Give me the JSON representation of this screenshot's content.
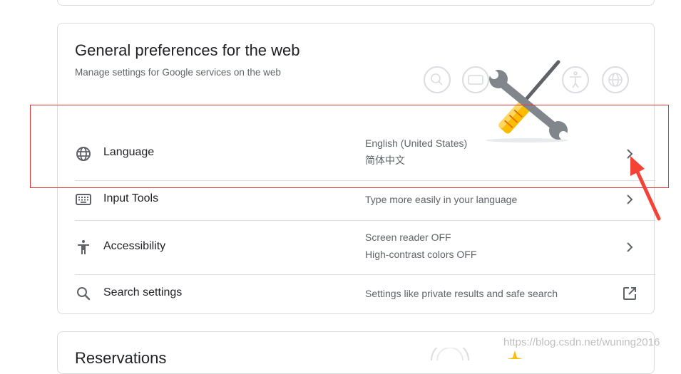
{
  "section": {
    "title": "General preferences for the web",
    "subtitle": "Manage settings for Google services on the web",
    "illustration_icons": [
      "search-icon",
      "keyboard-icon",
      "accessibility-icon",
      "globe-icon",
      "wrench-icon",
      "screwdriver-icon"
    ]
  },
  "rows": [
    {
      "label": "Language",
      "icon": "globe-icon",
      "value_line1": "English (United States)",
      "value_line2": "简体中文",
      "action_icon": "chevron-right-icon"
    },
    {
      "label": "Input Tools",
      "icon": "keyboard-icon",
      "value_line1": "Type more easily in your language",
      "action_icon": "chevron-right-icon"
    },
    {
      "label": "Accessibility",
      "icon": "accessibility-icon",
      "value_line1": "Screen reader OFF",
      "value_line2": "High-contrast colors OFF",
      "action_icon": "chevron-right-icon"
    },
    {
      "label": "Search settings",
      "icon": "search-icon",
      "value_line1": "Settings like private results and safe search",
      "action_icon": "open-in-new-icon"
    }
  ],
  "next_section": {
    "title": "Reservations"
  },
  "annotation": {
    "box_color": "#e53935",
    "arrow_color": "#f44336"
  },
  "watermark": "https://blog.csdn.net/wuning2016",
  "colors": {
    "text_primary": "#202124",
    "text_secondary": "#5f6368",
    "divider": "#dadce0",
    "tool_yellow": "#fbbc04",
    "tool_gray": "#80868b"
  }
}
